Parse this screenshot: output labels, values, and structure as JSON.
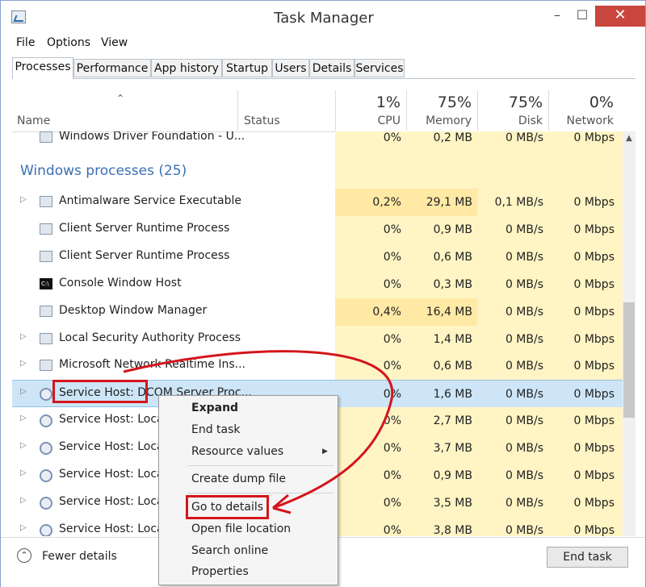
{
  "window": {
    "title": "Task Manager",
    "min": "–",
    "max": "☐",
    "close": "✕"
  },
  "menu": [
    "File",
    "Options",
    "View"
  ],
  "tabs": [
    "Processes",
    "Performance",
    "App history",
    "Startup",
    "Users",
    "Details",
    "Services"
  ],
  "columns": {
    "name": "Name",
    "status": "Status",
    "cpu": {
      "pct": "1%",
      "label": "CPU"
    },
    "memory": {
      "pct": "75%",
      "label": "Memory"
    },
    "disk": {
      "pct": "75%",
      "label": "Disk"
    },
    "network": {
      "pct": "0%",
      "label": "Network"
    }
  },
  "top_row": {
    "name": "Windows Driver Foundation - U...",
    "cpu": "0%",
    "memory": "0,2 MB",
    "disk": "0 MB/s",
    "network": "0 Mbps"
  },
  "group": {
    "label": "Windows processes (25)"
  },
  "rows": [
    {
      "name": "Antimalware Service Executable",
      "cpu": "0,2%",
      "memory": "29,1 MB",
      "disk": "0,1 MB/s",
      "network": "0 Mbps",
      "expander": true,
      "icon": "window"
    },
    {
      "name": "Client Server Runtime Process",
      "cpu": "0%",
      "memory": "0,9 MB",
      "disk": "0 MB/s",
      "network": "0 Mbps",
      "expander": false,
      "icon": "window"
    },
    {
      "name": "Client Server Runtime Process",
      "cpu": "0%",
      "memory": "0,6 MB",
      "disk": "0 MB/s",
      "network": "0 Mbps",
      "expander": false,
      "icon": "window"
    },
    {
      "name": "Console Window Host",
      "cpu": "0%",
      "memory": "0,3 MB",
      "disk": "0 MB/s",
      "network": "0 Mbps",
      "expander": false,
      "icon": "console"
    },
    {
      "name": "Desktop Window Manager",
      "cpu": "0,4%",
      "memory": "16,4 MB",
      "disk": "0 MB/s",
      "network": "0 Mbps",
      "expander": false,
      "icon": "window"
    },
    {
      "name": "Local Security Authority Process",
      "cpu": "0%",
      "memory": "1,4 MB",
      "disk": "0 MB/s",
      "network": "0 Mbps",
      "expander": true,
      "icon": "window"
    },
    {
      "name": "Microsoft Network Realtime Ins...",
      "cpu": "0%",
      "memory": "0,6 MB",
      "disk": "0 MB/s",
      "network": "0 Mbps",
      "expander": true,
      "icon": "window"
    },
    {
      "name": "Service Host: DCOM Server Proc...",
      "cpu": "0%",
      "memory": "1,6 MB",
      "disk": "0 MB/s",
      "network": "0 Mbps",
      "expander": true,
      "icon": "gear",
      "selected": true
    },
    {
      "name": "Service Host: Local",
      "cpu": "0%",
      "memory": "2,7 MB",
      "disk": "0 MB/s",
      "network": "0 Mbps",
      "expander": true,
      "icon": "gear"
    },
    {
      "name": "Service Host: Local",
      "cpu": "0%",
      "memory": "3,7 MB",
      "disk": "0 MB/s",
      "network": "0 Mbps",
      "expander": true,
      "icon": "gear"
    },
    {
      "name": "Service Host: Local",
      "cpu": "0%",
      "memory": "0,9 MB",
      "disk": "0 MB/s",
      "network": "0 Mbps",
      "expander": true,
      "icon": "gear"
    },
    {
      "name": "Service Host: Local",
      "cpu": "0%",
      "memory": "3,5 MB",
      "disk": "0 MB/s",
      "network": "0 Mbps",
      "expander": true,
      "icon": "gear"
    },
    {
      "name": "Service Host: Local",
      "cpu": "0%",
      "memory": "3,8 MB",
      "disk": "0 MB/s",
      "network": "0 Mbps",
      "expander": true,
      "icon": "gear"
    }
  ],
  "context_menu": [
    "Expand",
    "End task",
    "Resource values",
    "Create dump file",
    "Go to details",
    "Open file location",
    "Search online",
    "Properties"
  ],
  "footer": {
    "fewer_details": "Fewer details",
    "end_task": "End task"
  },
  "colors": {
    "heat_light": "#fff4c4",
    "heat_medium": "#ffe9a5",
    "selected_row": "#cde5f7",
    "group_label": "#3b6fb4",
    "annotation": "#d4151c",
    "close_button": "#c8463d"
  }
}
